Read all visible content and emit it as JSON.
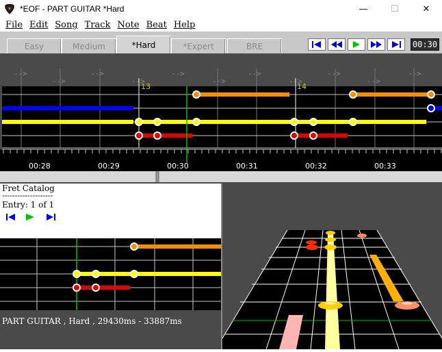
{
  "window": {
    "title": "*EOF - PART GUITAR  *Hard",
    "minimize_glyph": "—",
    "maximize_glyph": "☐",
    "close_glyph": "✕"
  },
  "menu": [
    "File",
    "Edit",
    "Song",
    "Track",
    "Note",
    "Beat",
    "Help"
  ],
  "difficulty_tabs": [
    {
      "label": "Easy",
      "active": false
    },
    {
      "label": "Medium",
      "active": false
    },
    {
      "label": "*Hard",
      "active": true
    },
    {
      "label": "*Expert",
      "active": false
    },
    {
      "label": "BRE",
      "active": false
    }
  ],
  "transport": {
    "buttons": [
      "seek-start",
      "rewind",
      "play",
      "fast-forward",
      "seek-end"
    ],
    "time_display": "00:30"
  },
  "piano_roll": {
    "measure_markers": [
      "13",
      "14"
    ],
    "timeline_labels": [
      "00:28",
      "00:29",
      "00:30",
      "00:31",
      "00:32",
      "00:33"
    ],
    "beat_arrow": "-->"
  },
  "fret_catalog": {
    "title": "Fret Catalog",
    "separator": "--------------------",
    "entry": "Entry: 1 of 1"
  },
  "status": {
    "text": "PART GUITAR , Hard , 29430ms - 33887ms"
  },
  "colors": {
    "orange": "#ff8c00",
    "yellow": "#ffff00",
    "red": "#e00000",
    "blue": "#0000ff",
    "green": "#00c000",
    "transport_blue": "#0000e0"
  }
}
